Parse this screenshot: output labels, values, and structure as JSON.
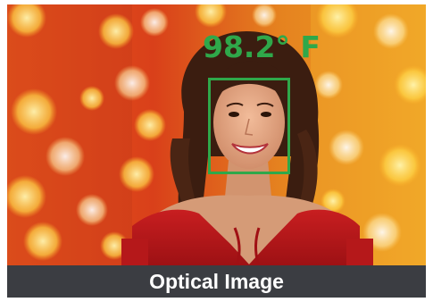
{
  "overlay": {
    "temperature": "98.2° F",
    "color": "#2fa84a"
  },
  "caption": {
    "label": "Optical Image",
    "background": "#3b3d42"
  },
  "scene": {
    "subject": "smiling-woman-photo",
    "background": "bokeh-lights"
  }
}
